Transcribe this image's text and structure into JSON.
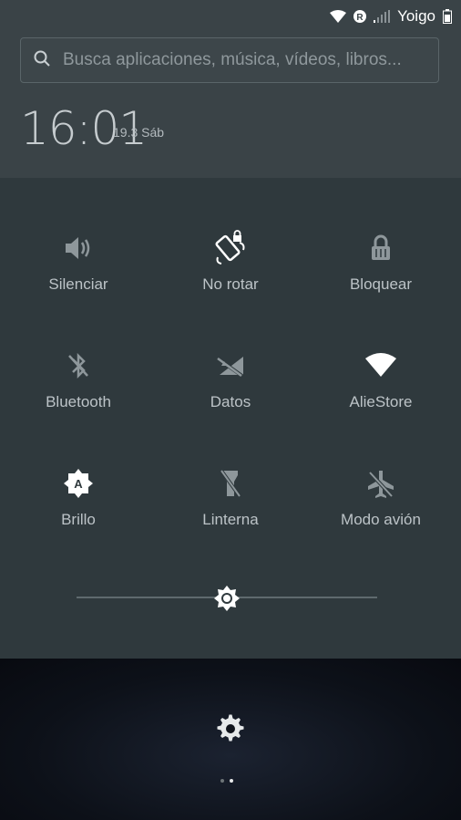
{
  "status_bar": {
    "carrier": "Yoigo",
    "icons": [
      "wifi-icon",
      "roaming-icon",
      "signal-icon",
      "battery-icon"
    ],
    "roaming_letter": "R"
  },
  "search": {
    "placeholder": "Busca aplicaciones, música, vídeos, libros..."
  },
  "clock": {
    "time": "16:01",
    "date": "19.3 Sáb"
  },
  "toggles": [
    {
      "label": "Silenciar",
      "icon": "speaker-icon",
      "active": false
    },
    {
      "label": "No rotar",
      "icon": "rotate-lock-icon",
      "active": true
    },
    {
      "label": "Bloquear",
      "icon": "lock-icon",
      "active": false
    },
    {
      "label": "Bluetooth",
      "icon": "bluetooth-off-icon",
      "active": false
    },
    {
      "label": "Datos",
      "icon": "data-off-icon",
      "active": false
    },
    {
      "label": "AlieStore",
      "icon": "wifi-icon",
      "active": true
    },
    {
      "label": "Brillo",
      "icon": "auto-brightness-icon",
      "active": true
    },
    {
      "label": "Linterna",
      "icon": "flashlight-off-icon",
      "active": false
    },
    {
      "label": "Modo avión",
      "icon": "airplane-off-icon",
      "active": false
    }
  ],
  "brightness": {
    "level": 0.5
  },
  "pager": {
    "pages": 2,
    "current": 2
  },
  "colors": {
    "active": "#ffffff",
    "inactive": "#8e979b"
  }
}
